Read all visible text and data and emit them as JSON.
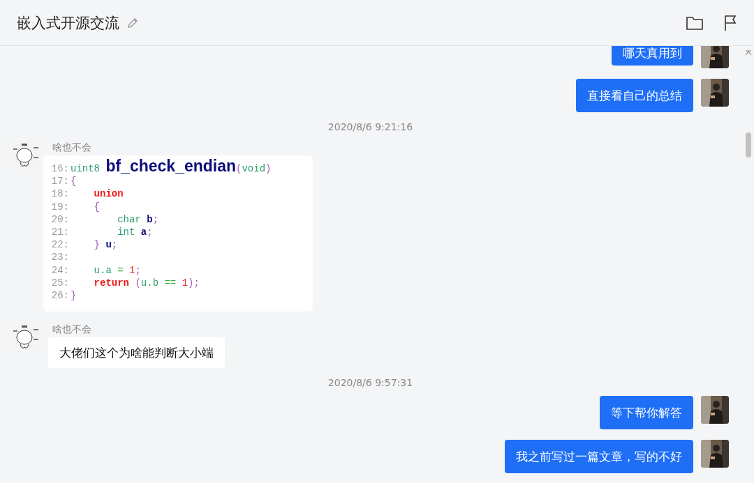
{
  "header": {
    "title": "嵌入式开源交流"
  },
  "messages": [
    {
      "kind": "text",
      "outgoing": true,
      "text": "哪天真用到"
    },
    {
      "kind": "text",
      "outgoing": true,
      "text": "直接看自己的总结"
    },
    {
      "kind": "time",
      "text": "2020/8/6 9:21:16"
    },
    {
      "kind": "code",
      "outgoing": false,
      "sender": "啥也不会",
      "lines": [
        {
          "number": "16:",
          "tokens": [
            {
              "kind": "type",
              "text": "uint8 "
            },
            {
              "kind": "func",
              "text": "bf_check_endian"
            },
            {
              "kind": "punct",
              "text": "("
            },
            {
              "kind": "type",
              "text": "void"
            },
            {
              "kind": "punct",
              "text": ")"
            }
          ]
        },
        {
          "number": "17:",
          "tokens": [
            {
              "kind": "punct",
              "text": "{"
            }
          ]
        },
        {
          "number": "18:",
          "tokens": [
            {
              "kind": "kw",
              "text": "    union"
            }
          ]
        },
        {
          "number": "19:",
          "tokens": [
            {
              "kind": "punct",
              "text": "    {"
            }
          ]
        },
        {
          "number": "20:",
          "tokens": [
            {
              "kind": "type",
              "text": "        char "
            },
            {
              "kind": "var",
              "text": "b"
            },
            {
              "kind": "punct",
              "text": ";"
            }
          ]
        },
        {
          "number": "21:",
          "tokens": [
            {
              "kind": "type",
              "text": "        int "
            },
            {
              "kind": "var",
              "text": "a"
            },
            {
              "kind": "punct",
              "text": ";"
            }
          ]
        },
        {
          "number": "22:",
          "tokens": [
            {
              "kind": "punct",
              "text": "    } "
            },
            {
              "kind": "var",
              "text": "u"
            },
            {
              "kind": "punct",
              "text": ";"
            }
          ]
        },
        {
          "number": "23:"
        },
        {
          "number": "24:",
          "tokens": [
            {
              "kind": "type",
              "text": "    u.a "
            },
            {
              "kind": "op",
              "text": "= "
            },
            {
              "kind": "num",
              "text": "1"
            },
            {
              "kind": "punct",
              "text": ";"
            }
          ]
        },
        {
          "number": "25:",
          "tokens": [
            {
              "kind": "kw",
              "text": "    return "
            },
            {
              "kind": "punct",
              "text": "("
            },
            {
              "kind": "type",
              "text": "u.b "
            },
            {
              "kind": "op",
              "text": "== "
            },
            {
              "kind": "num",
              "text": "1"
            },
            {
              "kind": "punct",
              "text": ");"
            }
          ]
        },
        {
          "number": "26:",
          "tokens": [
            {
              "kind": "punct",
              "text": "}"
            }
          ]
        }
      ]
    },
    {
      "kind": "text",
      "outgoing": false,
      "sender": "啥也不会",
      "text": "大佬们这个为啥能判断大小端"
    },
    {
      "kind": "time",
      "text": "2020/8/6 9:57:31"
    },
    {
      "kind": "text",
      "outgoing": true,
      "text": "等下帮你解答"
    },
    {
      "kind": "text",
      "outgoing": true,
      "text": "我之前写过一篇文章，写的不好"
    }
  ]
}
